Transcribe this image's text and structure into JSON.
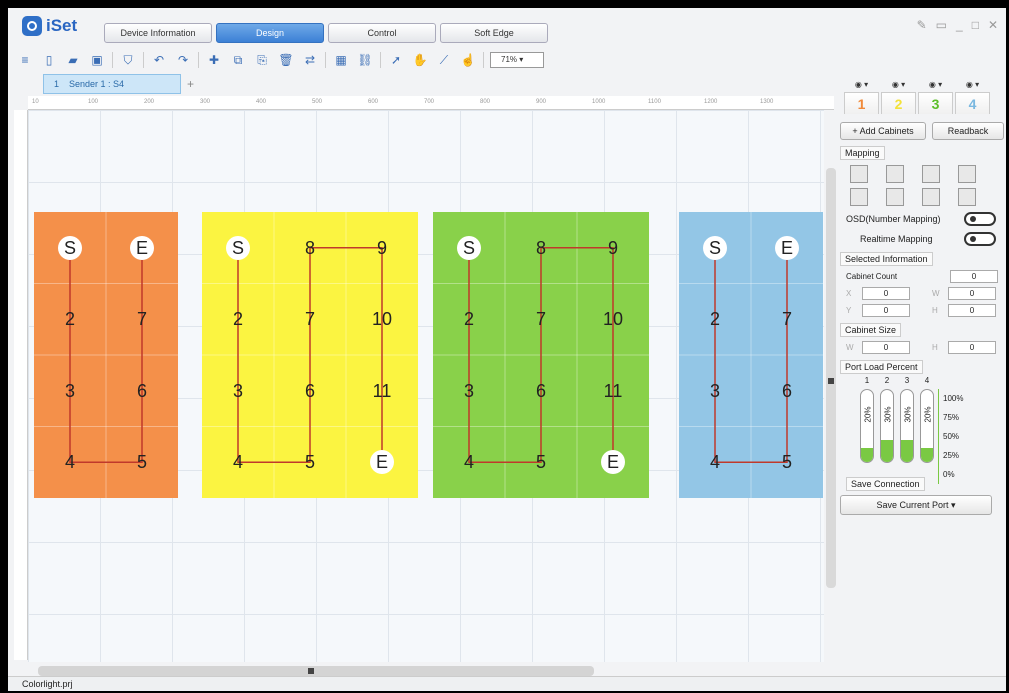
{
  "app": {
    "name": "iSet",
    "status": "Colorlight.prj"
  },
  "main_tabs": [
    "Device Information",
    "Design",
    "Control",
    "Soft Edge"
  ],
  "active_main_tab": 1,
  "toolbar": {
    "zoom": "71%"
  },
  "sender_tab": {
    "index": "1",
    "label": "Sender 1 : S4"
  },
  "ruler_labels": [
    "10",
    "100",
    "200",
    "300",
    "400",
    "500",
    "600",
    "700",
    "800",
    "900",
    "1000",
    "1100",
    "1200",
    "1300"
  ],
  "port_tabs": [
    {
      "n": "1",
      "color": "#f08a3a"
    },
    {
      "n": "2",
      "color": "#f3e23a"
    },
    {
      "n": "3",
      "color": "#5cbf2a"
    },
    {
      "n": "4",
      "color": "#7ab8e0"
    }
  ],
  "panel": {
    "add_cabinets": "+ Add Cabinets",
    "readback": "Readback",
    "mapping": "Mapping",
    "osd": "OSD(Number Mapping)",
    "realtime": "Realtime Mapping",
    "selected_info": "Selected Information",
    "cabinet_count": "Cabinet Count",
    "cabinet_count_val": "0",
    "x": "0",
    "y": "0",
    "w": "0",
    "h": "0",
    "cabinet_size": "Cabinet Size",
    "size_w": "0",
    "size_h": "0",
    "port_load": "Port Load Percent",
    "ports": [
      {
        "n": "1",
        "pct": "20%",
        "v": 0.2
      },
      {
        "n": "2",
        "pct": "30%",
        "v": 0.3
      },
      {
        "n": "3",
        "pct": "30%",
        "v": 0.3
      },
      {
        "n": "4",
        "pct": "20%",
        "v": 0.2
      }
    ],
    "scale": [
      "100%",
      "75%",
      "50%",
      "25%",
      "0%"
    ],
    "save_connection": "Save Connection",
    "save_current": "Save Current Port"
  },
  "cabinets": [
    {
      "color": "#f4904a",
      "cols": 2,
      "rows": 4,
      "labels": [
        "S",
        "E",
        "2",
        "7",
        "3",
        "6",
        "4",
        "5"
      ],
      "path": [
        [
          0,
          0
        ],
        [
          0,
          3
        ],
        [
          1,
          3
        ],
        [
          1,
          0
        ]
      ]
    },
    {
      "color": "#fbf441",
      "cols": 3,
      "rows": 4,
      "labels": [
        "S",
        "8",
        "9",
        "2",
        "7",
        "10",
        "3",
        "6",
        "11",
        "4",
        "5",
        "E"
      ],
      "path": [
        [
          0,
          0
        ],
        [
          0,
          3
        ],
        [
          1,
          3
        ],
        [
          1,
          0
        ],
        [
          2,
          0
        ],
        [
          2,
          3
        ]
      ]
    },
    {
      "color": "#89d14a",
      "cols": 3,
      "rows": 4,
      "labels": [
        "S",
        "8",
        "9",
        "2",
        "7",
        "10",
        "3",
        "6",
        "11",
        "4",
        "5",
        "E"
      ],
      "path": [
        [
          0,
          0
        ],
        [
          0,
          3
        ],
        [
          1,
          3
        ],
        [
          1,
          0
        ],
        [
          2,
          0
        ],
        [
          2,
          3
        ]
      ]
    },
    {
      "color": "#93c6e6",
      "cols": 2,
      "rows": 4,
      "labels": [
        "S",
        "E",
        "2",
        "7",
        "3",
        "6",
        "4",
        "5"
      ],
      "path": [
        [
          0,
          0
        ],
        [
          0,
          3
        ],
        [
          1,
          3
        ],
        [
          1,
          0
        ]
      ]
    }
  ]
}
